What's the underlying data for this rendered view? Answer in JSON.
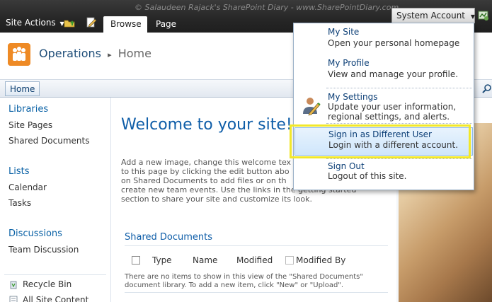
{
  "watermark": "© Salaudeen Rajack's SharePoint Diary - www.SharePointDiary.com",
  "ribbon": {
    "site_actions_label": "Site Actions",
    "tabs": [
      {
        "label": "Browse",
        "selected": true
      },
      {
        "label": "Page",
        "selected": false
      }
    ],
    "user_menu_label": "System Account"
  },
  "title_area": {
    "site_title": "Operations",
    "separator": "▸",
    "page_name": "Home"
  },
  "top_nav": {
    "home_label": "Home"
  },
  "quick_launch": {
    "libraries": {
      "heading": "Libraries",
      "items": [
        "Site Pages",
        "Shared Documents"
      ]
    },
    "lists": {
      "heading": "Lists",
      "items": [
        "Calendar",
        "Tasks"
      ]
    },
    "discussions": {
      "heading": "Discussions",
      "items": [
        "Team Discussion"
      ]
    },
    "footer_items": [
      "Recycle Bin",
      "All Site Content"
    ]
  },
  "main": {
    "welcome_title": "Welcome to your site!",
    "intro_lines": [
      "Add a new image, change this welcome tex",
      "to this page by clicking the edit button abo",
      "on Shared Documents to add files or on th",
      "create new team events. Use the links in the getting started",
      "section to share your site and customize its look."
    ],
    "shared_documents": {
      "title": "Shared Documents",
      "columns": [
        "Type",
        "Name",
        "Modified",
        "Modified By"
      ],
      "empty_message_lines": [
        "There are no items to show in this view of the \"Shared Documents\"",
        "document library. To add a new item, click \"New\" or \"Upload\"."
      ]
    }
  },
  "user_menu": {
    "items": [
      {
        "title": "My Site",
        "description": [
          "Open your personal homepage"
        ]
      },
      {
        "title": "My Profile",
        "description": [
          "View and manage your profile."
        ]
      },
      {
        "title": "My Settings",
        "description": [
          "Update your user information,",
          "regional settings, and alerts."
        ]
      },
      {
        "title": "Sign in as Different User",
        "description": [
          "Login with a different account."
        ],
        "highlighted": true
      },
      {
        "title": "Sign Out",
        "description": [
          "Logout of this site."
        ]
      }
    ]
  },
  "colors": {
    "ribbon_bg": "#262626",
    "link_blue": "#0e5da8",
    "highlight_yellow": "#f2e829"
  }
}
